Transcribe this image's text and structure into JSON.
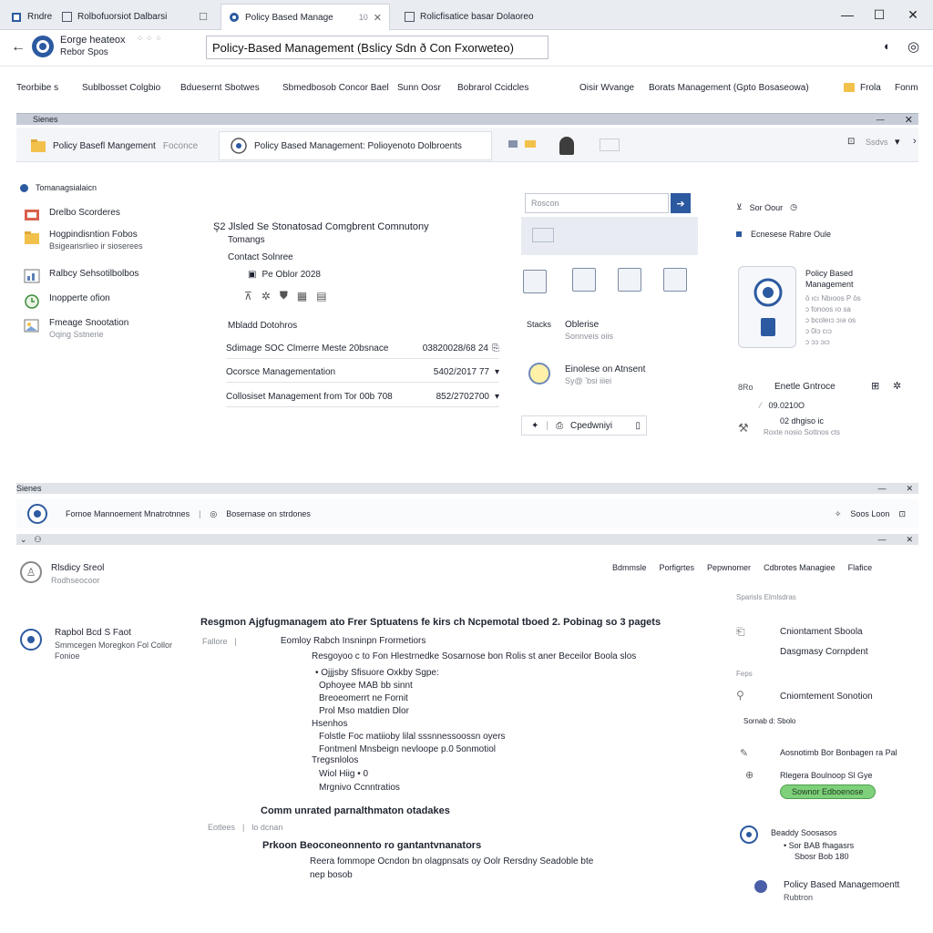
{
  "titlebar": {
    "home_label": "Rndre",
    "tabs": [
      {
        "label": "Rolbofuorsiot Dalbarsi"
      },
      {
        "label": "Policy Based Manage",
        "extra": "10"
      },
      {
        "label": "Rolicfisatice basar Dolaoreo"
      }
    ],
    "win": {
      "minimize": "—",
      "maximize": "☐",
      "close": "✕"
    }
  },
  "addressbar": {
    "profile_line1": "Eorge heateox",
    "profile_line2": "Rebor Spos",
    "url": "Policy-Based Management (Bslicy Sdn ð Con Fxorweteo)"
  },
  "menu": {
    "items": [
      "Teorbibe s",
      "Sublbosset Colgbio",
      "Bduesernt Sbotwes",
      "Sbmedbosob Concor Bael",
      "Sunn Oosr",
      "Bobrarol Ccidcles",
      "Oisir Wvange",
      "Borats Management (Gpto Bosaseowa)",
      "Frola",
      "Fonm"
    ]
  },
  "panel1": {
    "header": "Sienes",
    "tabs": [
      {
        "label": "Policy Basefl Mangement",
        "sub": "Foconce"
      },
      {
        "label": "Policy Based Management: Polioyenoto Dolbroents"
      }
    ],
    "tab_right": "Ssdvs",
    "section_label": "Tomanagsialaicn",
    "sidebar": [
      {
        "line1": "Drelbo Scorderes",
        "line2": ""
      },
      {
        "line1": "Hogpindisntion Fobos",
        "line2": "Bsigearisrlieo ir sioserees"
      },
      {
        "line1": "Ralbcy Sehsotilbolbos",
        "line2": ""
      },
      {
        "line1": "Inopperte ofion",
        "line2": ""
      },
      {
        "line1": "Fmeage Snootation",
        "line2": "Oqing Sstnerie"
      }
    ],
    "main": {
      "heading1": "Ş2 Jlsled Se Stonatosad Comgbrent Comnutony",
      "heading2": "Tomangs",
      "contact_label": "Contact Solnree",
      "date_label": "Pe Oblor 2028",
      "section_title": "Mbladd Dotohros",
      "rows": [
        {
          "label": "Sdimage SOC Clmerre Meste  20bsnace",
          "value": "03820028/68 24"
        },
        {
          "label": "Ocorsce Managementation",
          "value": "5402/2017 77"
        },
        {
          "label": "Collosiset Management from  Tor 00b 708",
          "value": "852/2702700"
        }
      ]
    },
    "center": {
      "search_placeholder": "Roscon",
      "stack_title": "Oblerise",
      "stack_sub": "Sonnveis oiis",
      "alert_title": "Einolese on Atnsent",
      "alert_sub": "Sy@ ʼbsi iiiei",
      "footer_label": "Cpedwniyi"
    },
    "right": {
      "top_label": "Sor Oour",
      "section_label": "Ecnesese Rabre Oule",
      "product_title_1": "Policy Based",
      "product_title_2": "Management",
      "product_lines": [
        "ō ıcı Nbıoos P ōs",
        "ɔ fonoos ıo sa",
        "ɔ bcoleıɔ ɔıǝ os",
        "ɔ 0iɔ cıɔ",
        "ɔ ɔɔ ɔıɔ"
      ],
      "stats_label": "8Ro",
      "stats_title": "Enetle Gntroce",
      "stats_rows": [
        "09.0210O",
        "02 dhgiso ic",
        "Roxte nosio Sottnos cts"
      ]
    }
  },
  "panel2": {
    "header": "Sienes",
    "bar_label": "Fornoe Mannoement Mnatrotnnes",
    "bar_label2": "Bosernase on strdones",
    "bar_right": "Soos Loon"
  },
  "panel3": {
    "left_title": "Rlsdicy Sreol",
    "left_sub": "Rodhseocoor",
    "toolbar": [
      "Bdmmsle",
      "Porfigrtes",
      "Pepwnomer",
      "Cdbrotes Managiee",
      "Flafice"
    ],
    "left2_title": "Rapbol Bcd S Faot",
    "left2_sub": "Smmcegen Moregkon Fol Collor",
    "left2_sub2": "Fonioe",
    "doc": {
      "title": "Resgmon Ajgfugmanagem ato Frer Sptuatens fe kirs ch Ncpemotal tboed 2. Pobinag so 3 pagets",
      "crumb": "Fallore",
      "subtitle": "Eomloy Rabch Insninpn Frormetiors",
      "intro": "Resgoyoo c to Fon Hlestrnedke Sosarnose bon Rolis st aner Beceilor Boola slos",
      "list1": [
        "• Ojjjsby Sfisuore Oxkby Sgpe:",
        "Ophoyee MAB bb sinnt",
        "Breoeomerrt ne Fornit",
        "Prol Mso matdien Dlor"
      ],
      "h2": "Hsenhos",
      "list2": [
        "Folstle Foc matiioby lilal sssnnessoossn oyers",
        "Fontmenl Mnsbeign nevloope p.0 5onmotiol"
      ],
      "h3": "Tregsnlolos",
      "list3": [
        "Wiol Hiig • 0",
        "Mrgnivo Ccnntratios"
      ],
      "section2": "Comm unrated parnalthmaton otadakes",
      "crumb2": "Eotlees",
      "crumb2b": "lo dcnan",
      "section3": "Prkoon Beoconeonnento ro gantantvnanators",
      "para3": "Reera fommope Ocndon bn olagpnsats oy Oolr Rersdny Seadoble bte",
      "para3b": "nep bosob"
    },
    "right": {
      "top": "Sparisls Elmlsdras",
      "items": [
        {
          "title": "Cniontament Sboola",
          "sub": "Dasgmasy Cornpdent"
        },
        {
          "title": "Cniomtement Sonotion",
          "sub": ""
        },
        {
          "title": "Aosnotimb Bor Bonbagen ra Pal",
          "sub": ""
        },
        {
          "title": "Rlegera Boulnoop Sl Gye"
        }
      ],
      "side_label1": "Feps",
      "side_label2": "Sornab d: Sbolo",
      "badge": "Sownor Edboenose",
      "bottom_title": "Beaddy Soosasos",
      "bottom_line1": "• Sor BAB fhagasrs",
      "bottom_line2": "Sbosr Bob 180",
      "footer_title": "Policy Based  Managemoentt",
      "footer_sub": "Rubtron"
    }
  },
  "colors": {
    "accent": "#2c5aa0",
    "green": "#7ed07a",
    "header_gray": "#c6cdd8"
  }
}
